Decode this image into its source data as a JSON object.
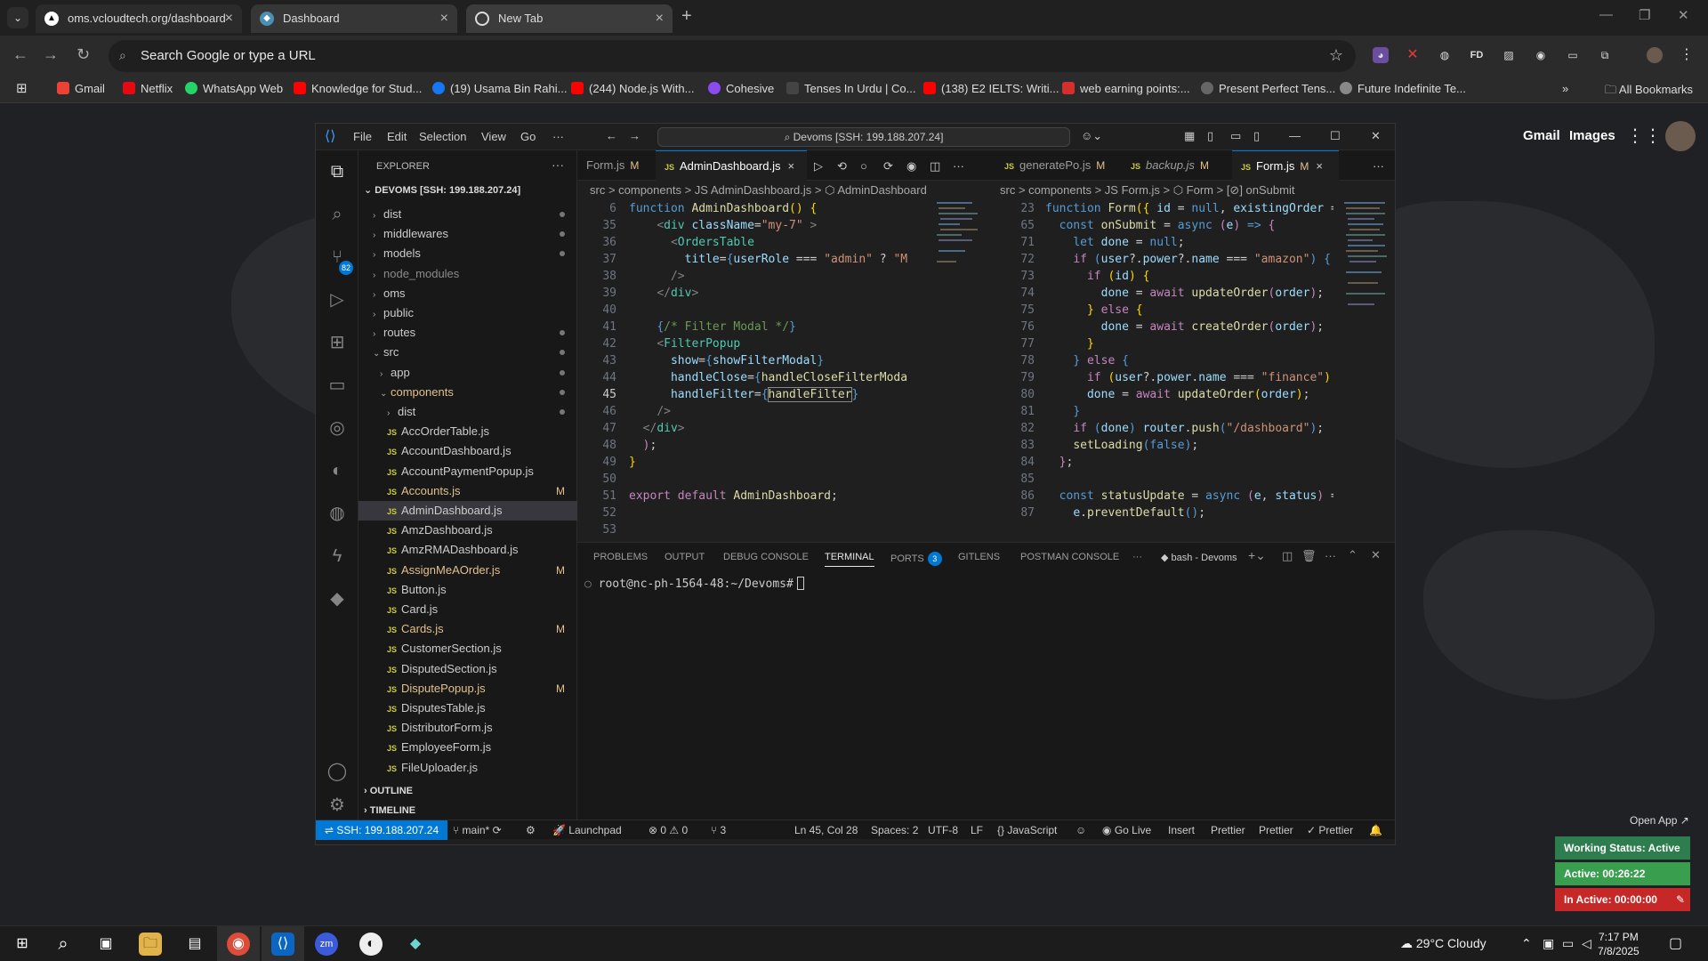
{
  "chrome": {
    "tabs": [
      {
        "title": "oms.vcloudtech.org/dashboard"
      },
      {
        "title": "Dashboard"
      },
      {
        "title": "New Tab"
      }
    ],
    "address": "Search Google or type a URL",
    "bookmarks": [
      {
        "label": "Gmail",
        "color": "#ea4335"
      },
      {
        "label": "Netflix",
        "color": "#e50914"
      },
      {
        "label": "WhatsApp Web",
        "color": "#25d366"
      },
      {
        "label": "Knowledge for Stud...",
        "color": "#ff0000"
      },
      {
        "label": "(19) Usama Bin Rahi...",
        "color": "#1877f2"
      },
      {
        "label": "(244) Node.js With...",
        "color": "#ff0000"
      },
      {
        "label": "Cohesive",
        "color": "#8a4cf0"
      },
      {
        "label": "Tenses In Urdu | Co...",
        "color": "#333333"
      },
      {
        "label": "(138) E2 IELTS: Writi...",
        "color": "#ff0000"
      },
      {
        "label": "web earning points:...",
        "color": "#d32f2f"
      },
      {
        "label": "Present Perfect Tens...",
        "color": "#666666"
      },
      {
        "label": "Future Indefinite Te...",
        "color": "#888888"
      }
    ],
    "all_bookmarks": "All Bookmarks"
  },
  "google": {
    "gmail": "Gmail",
    "images": "Images"
  },
  "vscode": {
    "menu": [
      "File",
      "Edit",
      "Selection",
      "View",
      "Go",
      "···"
    ],
    "command_center": "Devoms [SSH: 199.188.207.24]",
    "explorer_title": "EXPLORER",
    "root": "DEVOMS [SSH: 199.188.207.24]",
    "tree": [
      {
        "label": "dist",
        "type": "folder",
        "indent": 1,
        "deco": "dot"
      },
      {
        "label": "middlewares",
        "type": "folder",
        "indent": 1,
        "deco": "dot"
      },
      {
        "label": "models",
        "type": "folder",
        "indent": 1,
        "deco": "dot"
      },
      {
        "label": "node_modules",
        "type": "folder",
        "indent": 1,
        "deco": "",
        "dim": true
      },
      {
        "label": "oms",
        "type": "folder",
        "indent": 1,
        "deco": ""
      },
      {
        "label": "public",
        "type": "folder",
        "indent": 1,
        "deco": ""
      },
      {
        "label": "routes",
        "type": "folder",
        "indent": 1,
        "deco": "dot"
      },
      {
        "label": "src",
        "type": "open",
        "indent": 1,
        "deco": "dot"
      },
      {
        "label": "app",
        "type": "folder",
        "indent": 2,
        "deco": "dot"
      },
      {
        "label": "components",
        "type": "open",
        "indent": 2,
        "deco": "dot",
        "mod": true
      },
      {
        "label": "dist",
        "type": "folder",
        "indent": 3,
        "deco": "dot"
      },
      {
        "label": "AccOrderTable.js",
        "type": "js",
        "indent": 3,
        "deco": ""
      },
      {
        "label": "AccountDashboard.js",
        "type": "js",
        "indent": 3,
        "deco": ""
      },
      {
        "label": "AccountPaymentPopup.js",
        "type": "js",
        "indent": 3,
        "deco": ""
      },
      {
        "label": "Accounts.js",
        "type": "js",
        "indent": 3,
        "deco": "M",
        "mod": true
      },
      {
        "label": "AdminDashboard.js",
        "type": "js",
        "indent": 3,
        "deco": "",
        "sel": true
      },
      {
        "label": "AmzDashboard.js",
        "type": "js",
        "indent": 3,
        "deco": ""
      },
      {
        "label": "AmzRMADashboard.js",
        "type": "js",
        "indent": 3,
        "deco": ""
      },
      {
        "label": "AssignMeAOrder.js",
        "type": "js",
        "indent": 3,
        "deco": "M",
        "mod": true
      },
      {
        "label": "Button.js",
        "type": "js",
        "indent": 3,
        "deco": ""
      },
      {
        "label": "Card.js",
        "type": "js",
        "indent": 3,
        "deco": ""
      },
      {
        "label": "Cards.js",
        "type": "js",
        "indent": 3,
        "deco": "M",
        "mod": true
      },
      {
        "label": "CustomerSection.js",
        "type": "js",
        "indent": 3,
        "deco": ""
      },
      {
        "label": "DisputedSection.js",
        "type": "js",
        "indent": 3,
        "deco": ""
      },
      {
        "label": "DisputePopup.js",
        "type": "js",
        "indent": 3,
        "deco": "M",
        "mod": true
      },
      {
        "label": "DisputesTable.js",
        "type": "js",
        "indent": 3,
        "deco": ""
      },
      {
        "label": "DistributorForm.js",
        "type": "js",
        "indent": 3,
        "deco": ""
      },
      {
        "label": "EmployeeForm.js",
        "type": "js",
        "indent": 3,
        "deco": ""
      },
      {
        "label": "FileUploader.js",
        "type": "js",
        "indent": 3,
        "deco": ""
      }
    ],
    "outline": "OUTLINE",
    "timeline": "TIMELINE",
    "left_tabs": [
      {
        "label": "Form.js",
        "mark": "M"
      },
      {
        "label": "AdminDashboard.js",
        "mark": ""
      }
    ],
    "right_tabs": [
      {
        "label": "generatePo.js",
        "mark": "M"
      },
      {
        "label": "backup.js",
        "mark": "M"
      },
      {
        "label": "Form.js",
        "mark": "M"
      }
    ],
    "left_crumb": "src > components > JS AdminDashboard.js > ⬡ AdminDashboard",
    "right_crumb": "src > components > JS Form.js > ⬡ Form > [⊘] onSubmit",
    "left_lines": [
      "6",
      "35",
      "36",
      "37",
      "38",
      "39",
      "40",
      "41",
      "42",
      "43",
      "44",
      "45",
      "46",
      "47",
      "48",
      "49",
      "50",
      "51",
      "52",
      "53"
    ],
    "right_lines": [
      "23",
      "65",
      "71",
      "72",
      "73",
      "74",
      "75",
      "76",
      "77",
      "78",
      "79",
      "80",
      "81",
      "82",
      "83",
      "84",
      "85",
      "86",
      "87"
    ],
    "panel_tabs": [
      "PROBLEMS",
      "OUTPUT",
      "DEBUG CONSOLE",
      "TERMINAL",
      "PORTS",
      "GITLENS",
      "POSTMAN CONSOLE"
    ],
    "ports_count": "3",
    "terminal_name": "bash - Devoms",
    "prompt": "root@nc-ph-1564-48:~/Devoms#",
    "status": {
      "remote": "SSH: 199.188.207.24",
      "branch": "main*",
      "launchpad": "Launchpad",
      "problems": "⊗ 0 ⚠ 0",
      "ports": "⑂ 3",
      "position": "Ln 45, Col 28",
      "spaces": "Spaces: 2",
      "encoding": "UTF-8",
      "eol": "LF",
      "language": "{} JavaScript",
      "golive": "Go Live",
      "insert": "Insert",
      "prettier1": "Prettier",
      "prettier2": "Prettier",
      "prettier3": "✓ Prettier"
    }
  },
  "widget": {
    "open_app": "Open App ↗",
    "working": "Working Status: Active",
    "active": "Active: 00:26:22",
    "inactive": "In Active: 00:00:00"
  },
  "taskbar": {
    "weather": "29°C  Cloudy",
    "time": "7:17 PM",
    "date": "7/8/2025"
  },
  "colors": {
    "accent": "#0078d4",
    "modified": "#e2c08d",
    "widget_green": "#3a9e4f",
    "widget_red": "#c62828"
  }
}
